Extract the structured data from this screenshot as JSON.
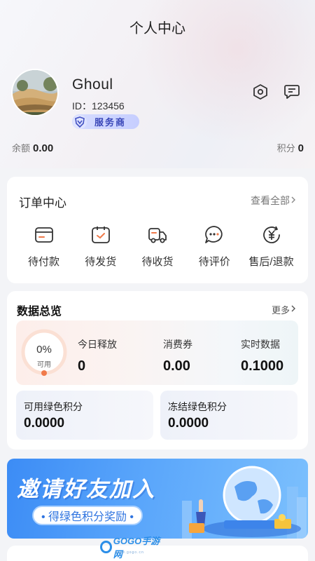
{
  "header": {
    "title": "个人中心"
  },
  "profile": {
    "username": "Ghoul",
    "id_text": "ID：123456",
    "badge_label": "服务商"
  },
  "icons": {
    "settings": "hexagon-settings-icon",
    "message": "chat-bubble-icon"
  },
  "balances": {
    "balance_label": "余额",
    "balance_value": "0.00",
    "points_label": "积分",
    "points_value": "0"
  },
  "orders": {
    "title": "订单中心",
    "view_all": "查看全部",
    "items": [
      {
        "label": "待付款",
        "icon": "wallet-card-icon"
      },
      {
        "label": "待发货",
        "icon": "box-check-icon"
      },
      {
        "label": "待收货",
        "icon": "delivery-truck-icon"
      },
      {
        "label": "待评价",
        "icon": "comment-dots-icon"
      },
      {
        "label": "售后/退款",
        "icon": "yen-refund-icon"
      }
    ]
  },
  "data_overview": {
    "title": "数据总览",
    "more": "更多",
    "progress": {
      "percent_text": "0%",
      "label": "可用",
      "value": 0
    },
    "stats": [
      {
        "label": "今日释放",
        "value": "0"
      },
      {
        "label": "消费券",
        "value": "0.00"
      },
      {
        "label": "实时数据",
        "value": "0.1000"
      }
    ],
    "green_points": [
      {
        "label": "可用绿色积分",
        "value": "0.0000"
      },
      {
        "label": "冻结绿色积分",
        "value": "0.0000"
      }
    ]
  },
  "banner": {
    "title": "邀请好友加入",
    "subtitle": "• 得绿色积分奖励 •"
  },
  "watermark": {
    "text": "GOGO手游网",
    "sub": "www.gogo.cn"
  },
  "colors": {
    "accent_orange": "#f07a4a",
    "badge_blue": "#3a47b8",
    "banner_blue": "#3c8cf5"
  }
}
